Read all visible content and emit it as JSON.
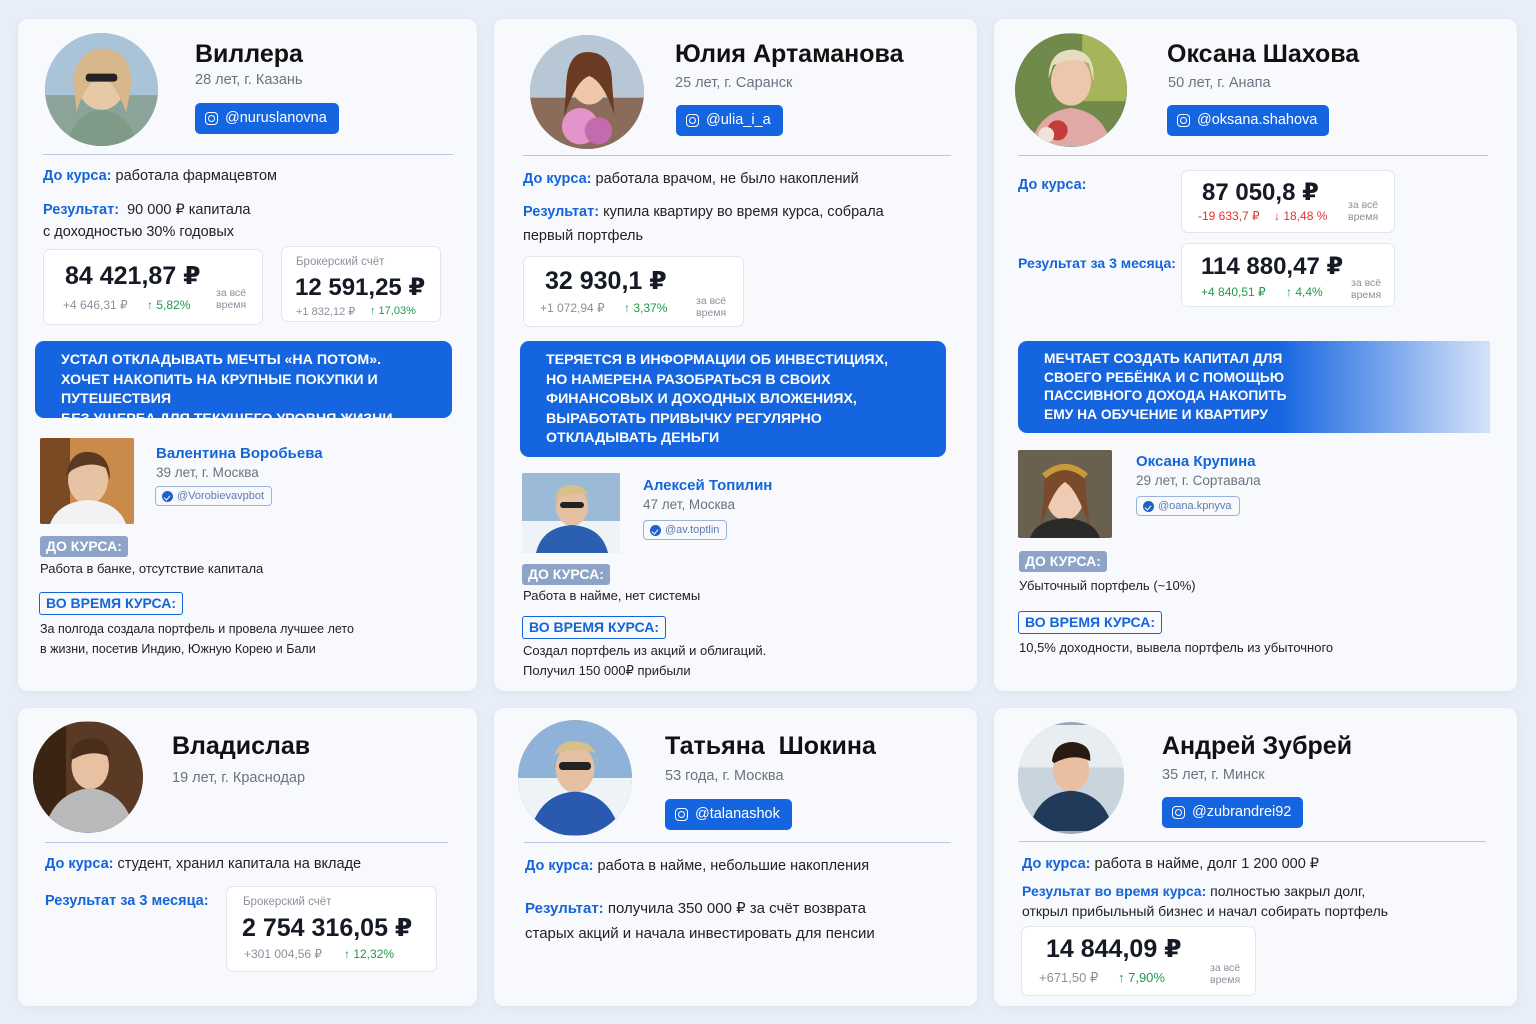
{
  "cards": [
    {
      "name": "Виллера",
      "sub": "28 лет, г. Казань",
      "insta": "@nuruslanovna",
      "before_label": "До курса:",
      "before_text": "работала фармацевтом",
      "result_label": "Результат:",
      "result_text": "90 000 ₽ капитала",
      "result_text2": "с доходностью 30% годовых",
      "stat1": {
        "value": "84 421,87 ₽",
        "delta": "+4 646,31 ₽",
        "pct": "↑ 5,82%",
        "per": "за всё время"
      },
      "stat2": {
        "caption": "Брокерский счёт",
        "value": "12 591,25 ₽",
        "delta": "+1 832,12 ₽",
        "pct": "↑ 17,03%"
      },
      "banner": "Устал откладывать мечты «на потом».\nХочет накопить на крупные покупки и путешествия\nбез ущерба для текущего уровня жизни",
      "person": {
        "name": "Валентина Воробьева",
        "sub": "39 лет, г. Москва",
        "tg": "@Vorobievavpbot",
        "before_tag": "ДО КУРСА:",
        "before_text": "Работа в банке, отсутствие капитала",
        "during_tag": "ВО ВРЕМЯ КУРСА:",
        "during_text": "За полгода создала портфель и провела лучшее лето\nв жизни, посетив Индию, Южную Корею и Бали"
      }
    },
    {
      "name": "Юлия Артаманова",
      "sub": "25 лет, г. Саранск",
      "insta": "@ulia_i_a",
      "before_label": "До курса:",
      "before_text": "работала врачом, не было накоплений",
      "result_label": "Результат:",
      "result_text": "купила квартиру во время курса, собрала",
      "result_text2": "первый портфель",
      "stat1": {
        "value": "32 930,1 ₽",
        "delta": "+1 072,94 ₽",
        "pct": "↑ 3,37%",
        "per": "за всё время"
      },
      "banner": "Теряется в информации об инвестициях,\nно намерена разобраться в своих\nфинансовых и доходных вложениях,\nвыработать привычку регулярно\nоткладывать деньги",
      "person": {
        "name": "Алексей Топилин",
        "sub": "47 лет, Москва",
        "tg": "@av.toptlin",
        "before_tag": "ДО КУРСА:",
        "before_text": "Работа в найме, нет системы",
        "during_tag": "ВО ВРЕМЯ КУРСА:",
        "during_text": "Создал портфель из акций и облигаций.\nПолучил 150 000₽ прибыли"
      }
    },
    {
      "name": "Оксана Шахова",
      "sub": "50 лет, г. Анапа",
      "insta": "@oksana.shahova",
      "before_label": "До курса:",
      "result_label": "Результат за 3 месяца:",
      "stat1": {
        "value": "87 050,8 ₽",
        "delta": "-19 633,7 ₽",
        "pct": "↓ 18,48 %",
        "per": "за всё время"
      },
      "stat2": {
        "value": "114 880,47 ₽",
        "delta": "+4 840,51 ₽",
        "pct": "↑ 4,4%",
        "per": "за всё время"
      },
      "banner": "Мечтает создать капитал для\nсвоего ребёнка и с помощью\nпассивного дохода накопить\nему на обучение и квартиру",
      "person": {
        "name": "Оксана Крупина",
        "sub": "29 лет, г. Сортавала",
        "tg": "@oana.kpnyva",
        "before_tag": "ДО КУРСА:",
        "before_text": "Убыточный портфель (~10%)",
        "during_tag": "ВО ВРЕМЯ КУРСА:",
        "during_text": "10,5% доходности, вывела портфель из убыточного"
      }
    },
    {
      "name": "Владислав",
      "sub": "19 лет, г. Краснодар",
      "before_label": "До курса:",
      "before_text": "студент, хранил капитала на вкладе",
      "result_label": "Результат за 3 месяца:",
      "stat1": {
        "caption": "Брокерский счёт",
        "value": "2 754 316,05 ₽",
        "delta": "+301 004,56 ₽",
        "pct": "↑ 12,32%"
      }
    },
    {
      "name": "Татьяна  Шокина",
      "sub": "53 года, г. Москва",
      "insta": "@talanashok",
      "before_label": "До курса:",
      "before_text": "работа в найме, небольшие  накопления",
      "result_label": "Результат:",
      "result_text": "получила 350 000 ₽ за счёт возврата",
      "result_text2": "старых акций и начала инвестировать для пенсии"
    },
    {
      "name": "Андрей Зубрей",
      "sub": "35 лет, г. Минск",
      "insta": "@zubrandrei92",
      "before_label": "До курса:",
      "before_text": "работа в найме, долг 1 200 000 ₽",
      "result_label": "Результат во время курса:",
      "result_text": "полностью закрыл долг,",
      "result_text2": "открыл прибыльный бизнес и начал собирать портфель",
      "stat1": {
        "value": "14 844,09 ₽",
        "delta": "+671,50 ₽",
        "pct": "↑ 7,90%",
        "per": "за всё время"
      }
    }
  ],
  "colors": {
    "accent": "#1565e0",
    "positive": "#1f9a4a",
    "negative": "#e0342f",
    "background": "#e8eef7"
  },
  "icons": [
    "instagram-icon",
    "telegram-verified-icon",
    "arrow-up-icon",
    "arrow-down-icon"
  ]
}
